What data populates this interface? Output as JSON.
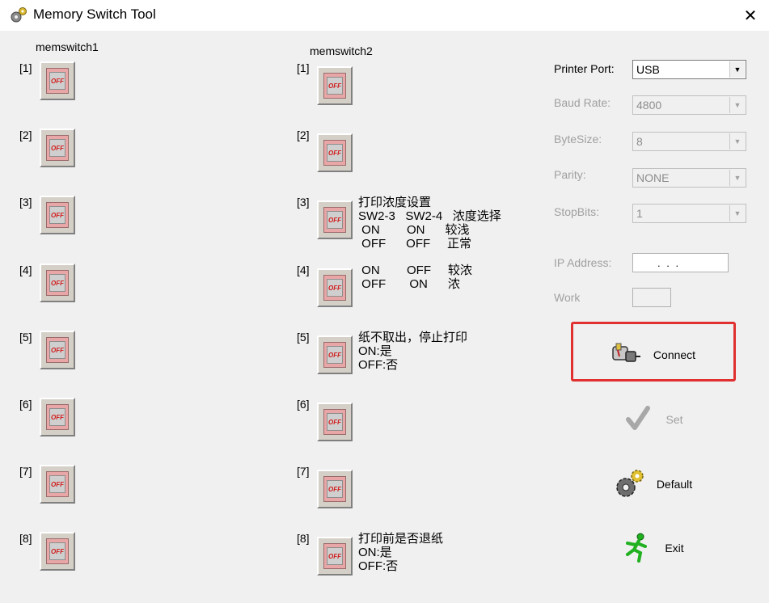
{
  "window": {
    "title": "Memory Switch Tool",
    "close_glyph": "✕"
  },
  "groups": {
    "memswitch1": "memswitch1",
    "memswitch2": "memswitch2"
  },
  "switch_state_text": "OFF",
  "switches1": [
    "[1]",
    "[2]",
    "[3]",
    "[4]",
    "[5]",
    "[6]",
    "[7]",
    "[8]"
  ],
  "switches2": [
    "[1]",
    "[2]",
    "[3]",
    "[4]",
    "[5]",
    "[6]",
    "[7]",
    "[8]"
  ],
  "notes": {
    "sw2_3": "打印浓度设置\nSW2-3   SW2-4   浓度选择\n ON        ON      较浅\n OFF      OFF     正常",
    "sw2_4": " ON        OFF     较浓\n OFF       ON      浓",
    "sw2_5": "纸不取出，停止打印\nON:是\nOFF:否",
    "sw2_8": "打印前是否退纸\nON:是\nOFF:否"
  },
  "settings": {
    "printer_port": {
      "label": "Printer Port:",
      "value": "USB"
    },
    "baud_rate": {
      "label": "Baud Rate:",
      "value": "4800"
    },
    "byte_size": {
      "label": "ByteSize:",
      "value": "8"
    },
    "parity": {
      "label": "Parity:",
      "value": "NONE"
    },
    "stop_bits": {
      "label": "StopBits:",
      "value": "1"
    },
    "ip_address": {
      "label": "IP Address:",
      "value": ".   .   ."
    },
    "work": {
      "label": "Work",
      "value": ""
    }
  },
  "buttons": {
    "connect": "Connect",
    "set": "Set",
    "default": "Default",
    "exit": "Exit"
  },
  "colors": {
    "highlight": "#e03030",
    "disabled_text": "#a0a0a0"
  }
}
